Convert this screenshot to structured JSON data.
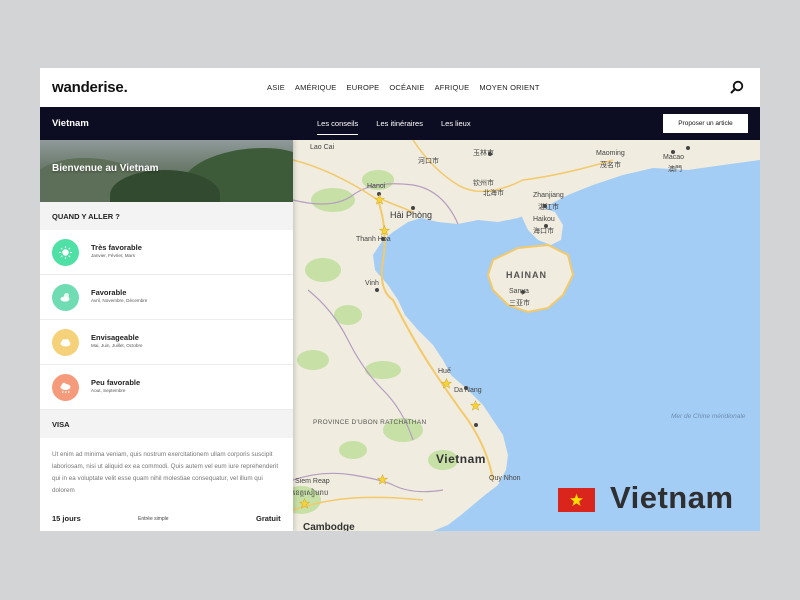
{
  "header": {
    "logo": "wanderise.",
    "nav": [
      "ASIE",
      "AMÉRIQUE",
      "EUROPE",
      "OCÉANIE",
      "AFRIQUE",
      "MOYEN ORIENT"
    ]
  },
  "subnav": {
    "title": "Vietnam",
    "tabs": [
      {
        "label": "Les conseils",
        "active": true
      },
      {
        "label": "Les itinéraires",
        "active": false
      },
      {
        "label": "Les lieux",
        "active": false
      }
    ],
    "cta": "Proposer un article"
  },
  "panel": {
    "hero_caption": "Bienvenue au Vietnam",
    "when_title": "QUAND Y ALLER ?",
    "seasons": [
      {
        "name": "Très favorable",
        "months": "Janvier, Février, Mars",
        "color": "#4fe0a6",
        "icon": "sun-icon"
      },
      {
        "name": "Favorable",
        "months": "Avril, Novembre, Décembre",
        "color": "#6fdcb4",
        "icon": "sun-cloud-icon"
      },
      {
        "name": "Envisageable",
        "months": "Mai, Juin, Juillet, Octobre",
        "color": "#f5d27a",
        "icon": "cloud-icon"
      },
      {
        "name": "Peu favorable",
        "months": "Aout, Septembre",
        "color": "#f59b7c",
        "icon": "rain-cloud-icon"
      }
    ],
    "visa_title": "VISA",
    "visa_text": "Ut enim ad minima veniam, quis nostrum exercitationem ullam corporis suscipit laboriosam, nisi ut aliquid ex ea commodi. Quis autem vel eum iure reprehenderit qui in ea voluptate velit esse quam nihil molestiae consequatur, vel illum qui dolorem",
    "visa_duration": "15 jours",
    "visa_entry": "Entrée simple",
    "visa_price": "Gratuit"
  },
  "map": {
    "labels": {
      "lao_cai": "Lao Cai",
      "hekou": "河口市",
      "yulin": "玉林市",
      "maoming": "Maoming",
      "maoming_cn": "茂名市",
      "macao": "Macao",
      "macao_cn": "澳門",
      "hanoi": "Hanoi",
      "haiphong": "Hải Phòng",
      "qinzhou": "钦州市",
      "beihai": "北海市",
      "zhanjiang": "Zhanjiang",
      "zhanjiang_cn": "湛江市",
      "haikou": "Haikou",
      "haikou_cn": "海口市",
      "thanh_hoa": "Thanh Hoa",
      "hainan": "HAINAN",
      "sanya": "Sanya",
      "sanya_cn": "三亚市",
      "vinh": "Vinh",
      "hue": "Huế",
      "da_nang": "Da Nang",
      "south_china_sea": "Mer de Chine méridionale",
      "province_ubon": "PROVINCE D'UBON RATCHATHAN",
      "vietnam": "Vietnam",
      "quy_nhon": "Quy Nhon",
      "siem_reap": "Siem Reap",
      "siem_reap_km": "ខេត្តសៀមរាប",
      "cambodia": "Cambodge"
    }
  },
  "overlay": {
    "country": "Vietnam"
  },
  "colors": {
    "dark_nav": "#0c0d22",
    "sea": "#a3cdf5",
    "land": "#f0ecdf",
    "star": "#f6d23c",
    "flag_red": "#da251d",
    "flag_star": "#ffde00"
  }
}
